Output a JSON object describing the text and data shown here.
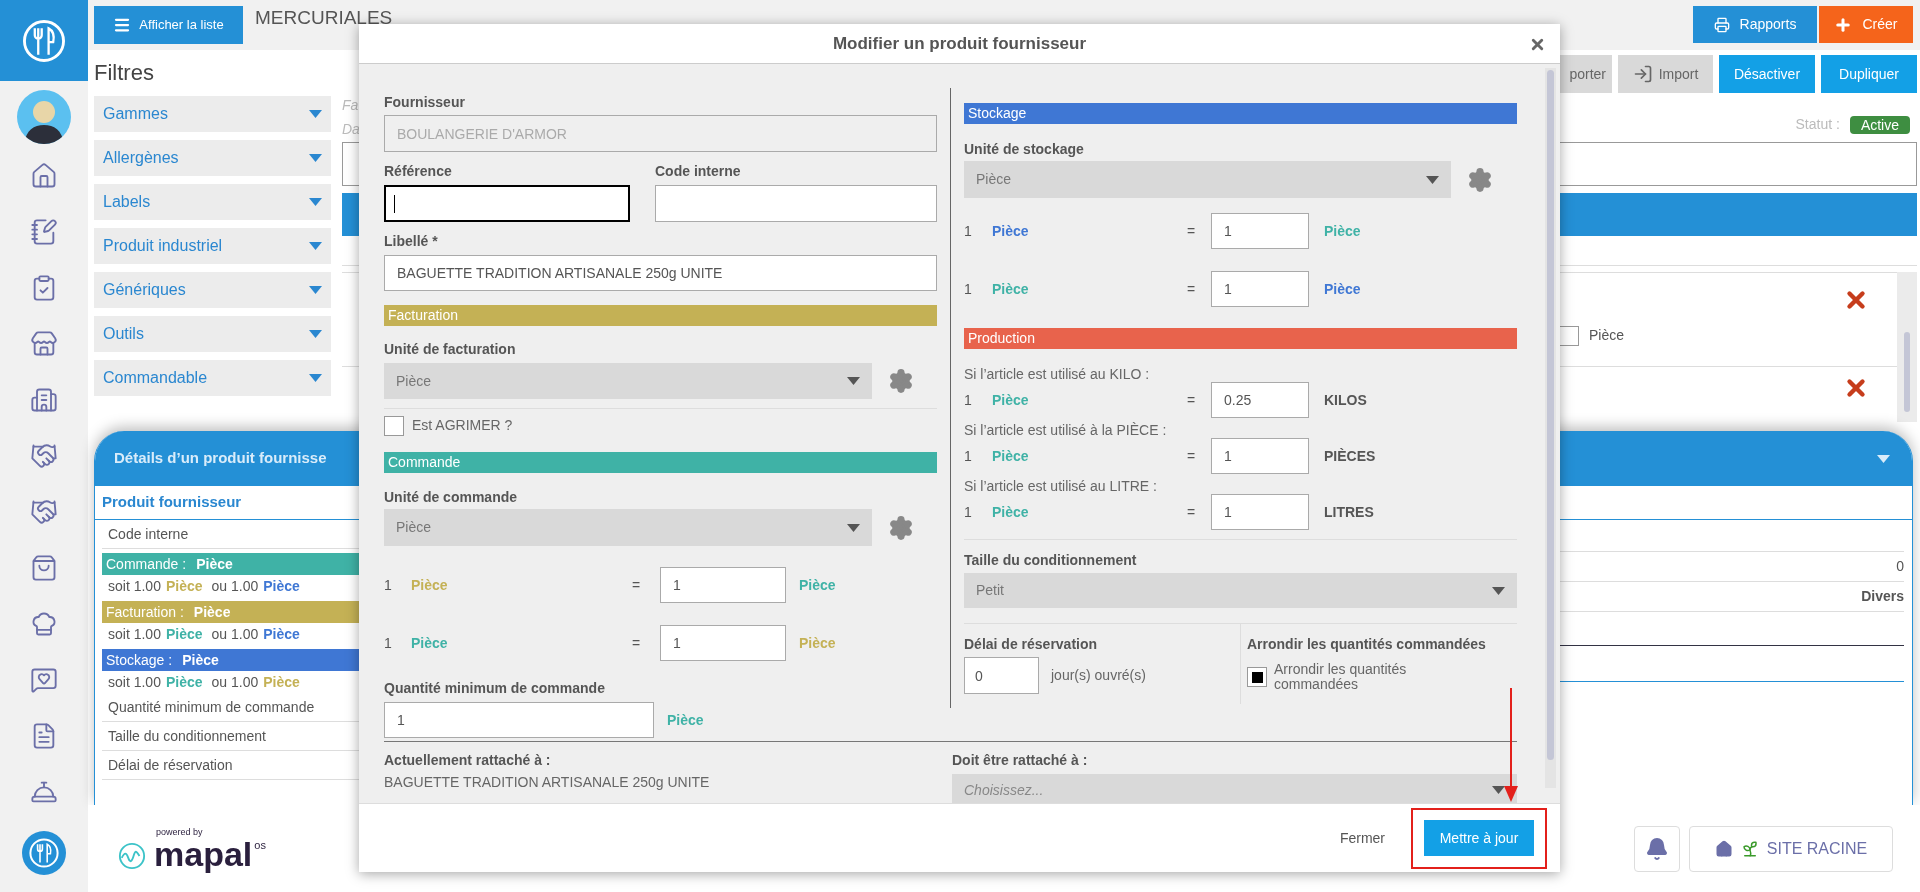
{
  "app_bar": {
    "list_button": "Afficher la liste",
    "title": "MERCURIALES",
    "actions": [
      {
        "label": "Rapports",
        "kind": "report"
      },
      {
        "label": "Créer",
        "kind": "create"
      }
    ]
  },
  "filters": {
    "title": "Filtres",
    "items": [
      "Gammes",
      "Allergènes",
      "Labels",
      "Produit industriel",
      "Génériques",
      "Outils",
      "Commandable"
    ]
  },
  "product": {
    "fragments": [
      "Fa",
      "Da"
    ],
    "toolbar": [
      {
        "label": "porter",
        "kind": "export"
      },
      {
        "label": "Import",
        "kind": "import"
      },
      {
        "label": "Désactiver",
        "kind": "primary"
      },
      {
        "label": "Dupliquer",
        "kind": "primary"
      }
    ],
    "status_label": "Statut :",
    "status": "Active",
    "line_unit": "Pièce",
    "line_unit_checked": false
  },
  "details_panel": {
    "title": "Détails d’un produit fournisse",
    "section": "Produit fournisseur",
    "rows": [
      {
        "kind": "plain",
        "label": "Code interne"
      },
      {
        "kind": "unit",
        "label": "Commande :",
        "unit": "Pièce",
        "color": "#3fb2a6",
        "line": {
          "lead": "soit 1.00",
          "first": {
            "text": "Pièce",
            "color": "#c4b155"
          },
          "middle": "ou 1.00",
          "second": {
            "text": "Pièce",
            "color": "#3f77d4"
          }
        }
      },
      {
        "kind": "unit",
        "label": "Facturation :",
        "unit": "Pièce",
        "color": "#c4b155",
        "line": {
          "lead": "soit 1.00",
          "first": {
            "text": "Pièce",
            "color": "#3fb2a6"
          },
          "middle": "ou 1.00",
          "second": {
            "text": "Pièce",
            "color": "#3f77d4"
          }
        }
      },
      {
        "kind": "unit",
        "label": "Stockage :",
        "unit": "Pièce",
        "color": "#3f77d4",
        "line": {
          "lead": "soit 1.00",
          "first": {
            "text": "Pièce",
            "color": "#3fb2a6"
          },
          "middle": "ou 1.00",
          "second": {
            "text": "Pièce",
            "color": "#c4b155"
          }
        }
      },
      {
        "kind": "plain",
        "label": "Quantité minimum de commande"
      },
      {
        "kind": "plain",
        "label": "Taille du conditionnement"
      },
      {
        "kind": "plain",
        "label": "Délai de réservation"
      }
    ],
    "side_values": [
      {
        "value": "0",
        "kind": "plain"
      },
      {
        "value": "Divers",
        "kind": "strong"
      }
    ]
  },
  "modal": {
    "title": "Modifier un produit fournisseur",
    "supplier": {
      "label": "Fournisseur",
      "value": "BOULANGERIE D'ARMOR",
      "disabled": true
    },
    "reference": {
      "label": "Référence",
      "focused": true
    },
    "internal_code": {
      "label": "Code interne",
      "focused": false
    },
    "name": {
      "label": "Libellé *",
      "value": "BAGUETTE TRADITION ARTISANALE 250g UNITE"
    },
    "billing": {
      "title": "Facturation",
      "color": "#c4b155",
      "unit_label": "Unité de facturation",
      "unit": "Pièce"
    },
    "agrimer": {
      "label": "Est AGRIMER ?",
      "checked": false
    },
    "ordering": {
      "title": "Commande",
      "color": "#3fb2a6",
      "unit_label": "Unité de commande",
      "unit": "Pièce",
      "conversions": [
        {
          "qty": "1",
          "from": {
            "text": "Pièce",
            "color": "#c4b155"
          },
          "eq": "=",
          "value": "1",
          "to": {
            "text": "Pièce",
            "color": "#3fb2a6"
          }
        },
        {
          "qty": "1",
          "from": {
            "text": "Pièce",
            "color": "#3fb2a6"
          },
          "eq": "=",
          "value": "1",
          "to": {
            "text": "Pièce",
            "color": "#c4b155"
          }
        }
      ]
    },
    "min_qty": {
      "label": "Quantité minimum de commande",
      "value": "1",
      "unit": {
        "text": "Pièce",
        "color": "#3fb2a6"
      }
    },
    "attached": {
      "label": "Actuellement rattaché à :",
      "value": "BAGUETTE TRADITION ARTISANALE 250g UNITE"
    },
    "storage": {
      "title": "Stockage",
      "color": "#3f77d4",
      "unit_label": "Unité de stockage",
      "unit": "Pièce",
      "conversions": [
        {
          "qty": "1",
          "from": {
            "text": "Pièce",
            "color": "#3f77d4"
          },
          "eq": "=",
          "value": "1",
          "to": {
            "text": "Pièce",
            "color": "#3fb2a6"
          }
        },
        {
          "qty": "1",
          "from": {
            "text": "Pièce",
            "color": "#3fb2a6"
          },
          "eq": "=",
          "value": "1",
          "to": {
            "text": "Pièce",
            "color": "#3f77d4"
          }
        }
      ]
    },
    "production": {
      "title": "Production",
      "color": "#e8634c",
      "rows": [
        {
          "caption": "Si l’article est utilisé au KILO :",
          "qty": "1",
          "from": {
            "text": "Pièce",
            "color": "#3fb2a6"
          },
          "eq": "=",
          "value": "0.25",
          "to": "KILOS"
        },
        {
          "caption": "Si l’article est utilisé à la PIÈCE :",
          "qty": "1",
          "from": {
            "text": "Pièce",
            "color": "#3fb2a6"
          },
          "eq": "=",
          "value": "1",
          "to": "PIÈCES"
        },
        {
          "caption": "Si l’article est utilisé au LITRE :",
          "qty": "1",
          "from": {
            "text": "Pièce",
            "color": "#3fb2a6"
          },
          "eq": "=",
          "value": "1",
          "to": "LITRES"
        }
      ]
    },
    "packaging": {
      "label": "Taille du conditionnement",
      "value": "Petit"
    },
    "delay": {
      "label": "Délai de réservation",
      "value": "0",
      "unit": "jour(s) ouvré(s)"
    },
    "rounding": {
      "label": "Arrondir les quantités commandées",
      "option": "Arrondir les quantités commandées",
      "checked": true
    },
    "target": {
      "label": "Doit être rattaché à :",
      "placeholder": "Choisissez..."
    },
    "buttons": [
      {
        "label": "Fermer",
        "kind": "link",
        "highlighted": false
      },
      {
        "label": "Mettre à jour",
        "kind": "primary",
        "highlighted": true
      }
    ]
  },
  "footer": {
    "powered": "powered by",
    "brand": "mapal",
    "brand_suffix": "os",
    "site": "SITE RACINE"
  }
}
